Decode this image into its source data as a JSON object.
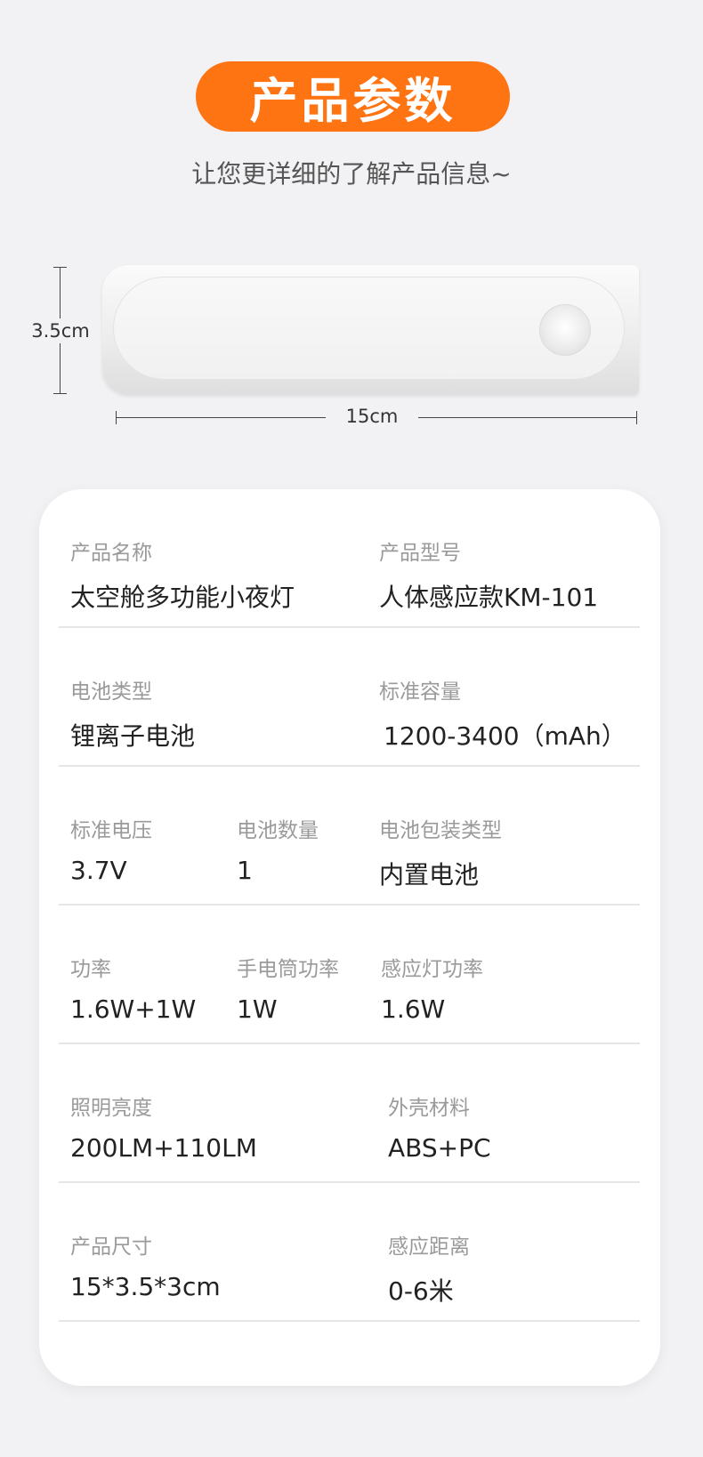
{
  "header": {
    "title": "产品参数",
    "subtitle": "让您更详细的了解产品信息~"
  },
  "dimensions": {
    "height_label": "3.5cm",
    "width_label": "15cm"
  },
  "colors": {
    "accent": "#ff7412",
    "background": "#f2f2f4",
    "card": "#ffffff"
  },
  "specs": {
    "rows": [
      [
        {
          "label": "产品名称",
          "value": "太空舱多功能小夜灯"
        },
        {
          "label": "产品型号",
          "value": "人体感应款KM-101"
        }
      ],
      [
        {
          "label": "电池类型",
          "value": "锂离子电池"
        },
        {
          "label": "标准容量",
          "value": "1200-3400（mAh）"
        }
      ],
      [
        {
          "label": "标准电压",
          "value": "3.7V"
        },
        {
          "label": "电池数量",
          "value": "1"
        },
        {
          "label": "电池包装类型",
          "value": "内置电池"
        }
      ],
      [
        {
          "label": "功率",
          "value": "1.6W+1W"
        },
        {
          "label": "手电筒功率",
          "value": "1W"
        },
        {
          "label": "感应灯功率",
          "value": "1.6W"
        }
      ],
      [
        {
          "label": "照明亮度",
          "value": "200LM+110LM"
        },
        {
          "label": "外壳材料",
          "value": "ABS+PC"
        }
      ],
      [
        {
          "label": "产品尺寸",
          "value": "15*3.5*3cm"
        },
        {
          "label": "感应距离",
          "value": "0-6米"
        }
      ]
    ]
  }
}
